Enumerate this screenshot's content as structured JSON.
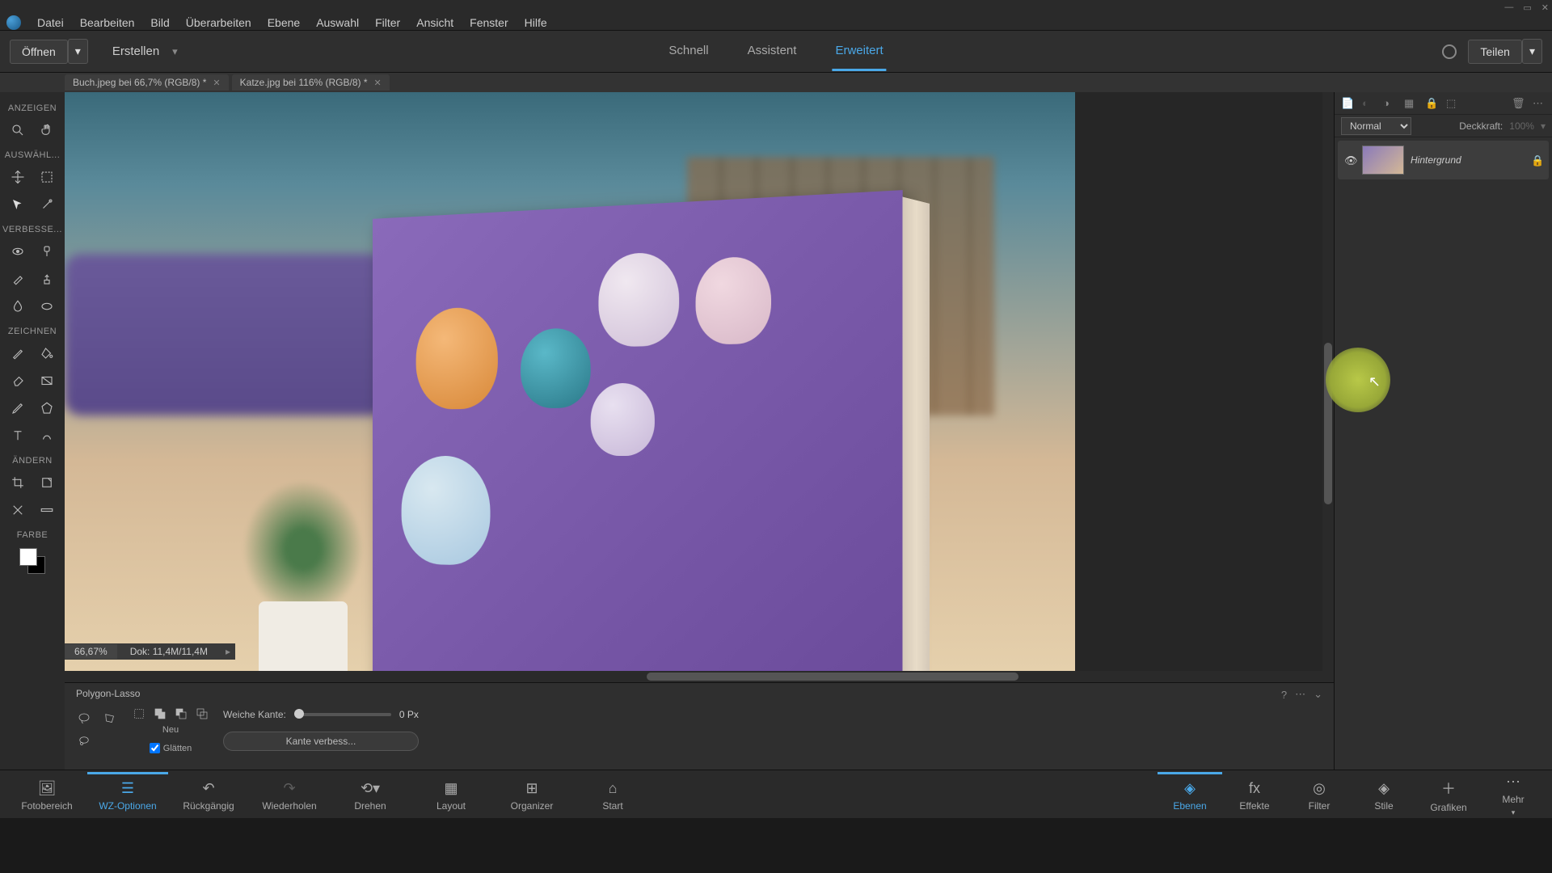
{
  "menu": [
    "Datei",
    "Bearbeiten",
    "Bild",
    "Überarbeiten",
    "Ebene",
    "Auswahl",
    "Filter",
    "Ansicht",
    "Fenster",
    "Hilfe"
  ],
  "actionbar": {
    "open": "Öffnen",
    "create": "Erstellen",
    "modes": [
      "Schnell",
      "Assistent",
      "Erweitert"
    ],
    "active_mode": 2,
    "share": "Teilen"
  },
  "tabs": [
    {
      "label": "Buch.jpeg bei 66,7% (RGB/8) *"
    },
    {
      "label": "Katze.jpg bei 116% (RGB/8) *"
    }
  ],
  "toolbar_sections": {
    "view": "ANZEIGEN",
    "select": "AUSWÄHL...",
    "enhance": "VERBESSE...",
    "draw": "ZEICHNEN",
    "modify": "ÄNDERN",
    "color": "FARBE"
  },
  "status": {
    "zoom": "66,67%",
    "doc": "Dok: 11,4M/11,4M"
  },
  "layers": {
    "blend_mode": "Normal",
    "opacity_label": "Deckkraft:",
    "opacity_value": "100%",
    "items": [
      {
        "name": "Hintergrund"
      }
    ]
  },
  "tool_options": {
    "tool_name": "Polygon-Lasso",
    "new_label": "Neu",
    "feather_label": "Weiche Kante:",
    "feather_value": "0 Px",
    "antialias_label": "Glätten",
    "refine_label": "Kante verbess..."
  },
  "bottombar": {
    "left": [
      "Fotobereich",
      "WZ-Optionen",
      "Rückgängig",
      "Wiederholen",
      "Drehen",
      "Layout",
      "Organizer",
      "Start"
    ],
    "left_active": 1,
    "right": [
      "Ebenen",
      "Effekte",
      "Filter",
      "Stile",
      "Grafiken",
      "Mehr"
    ],
    "right_active": 0
  }
}
